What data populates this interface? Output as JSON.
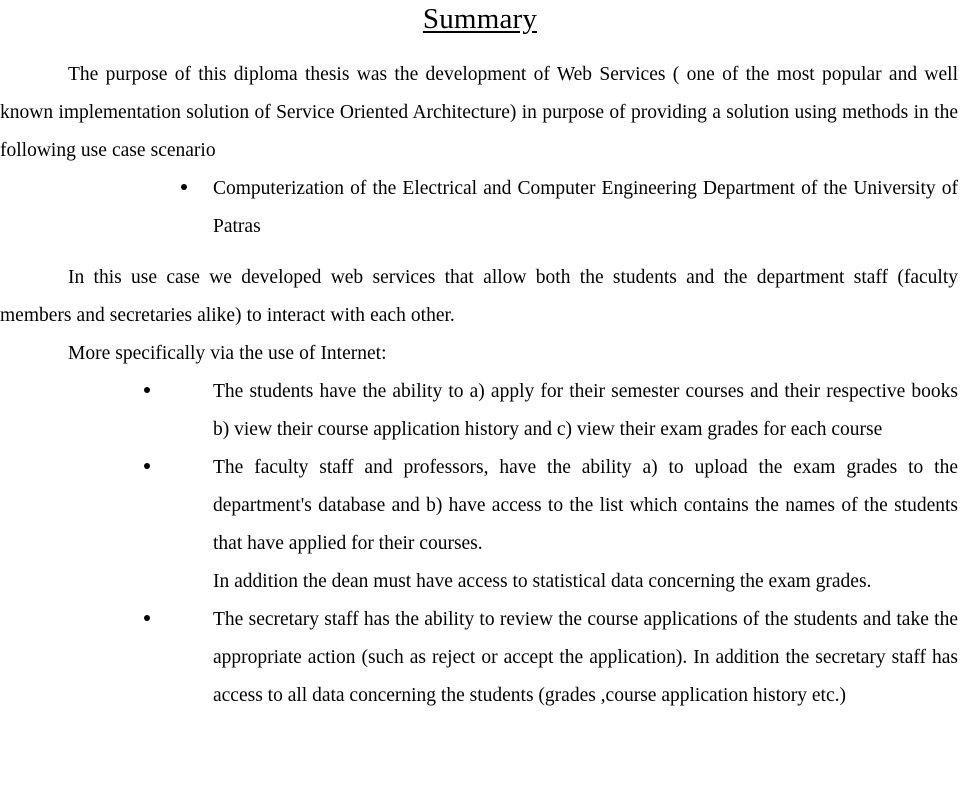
{
  "document": {
    "title": "Summary",
    "title_style": "underlined-centered",
    "text_color": "#000000",
    "background_color": "#ffffff"
  },
  "intro": {
    "paragraph_1": "The purpose of this diploma thesis was the development of Web Services ( one of the most popular and well known implementation solution of Service Oriented Architecture) in purpose of providing a solution using methods in the following use case scenario"
  },
  "scenario_list": {
    "bullet_symbol": "•",
    "items": [
      {
        "text": "Computerization of the Electrical and Computer Engineering Department of the University of Patras"
      }
    ]
  },
  "middle": {
    "paragraph_2": "In this use case we developed web services that allow both the students and the department staff (faculty members and secretaries alike) to interact with each other.",
    "paragraph_3": "More specifically via the use of Internet:"
  },
  "capabilities_list": {
    "bullet_symbol": "•",
    "items": [
      {
        "text": "The students have the ability to a) apply for their semester courses and their respective books b) view their course application history and c) view their exam grades for each course",
        "sub": ""
      },
      {
        "text": "The faculty staff and professors, have the ability a) to upload the exam grades to the department's database and b) have access to the list which contains the names of the students that have applied for their courses.",
        "sub": "In addition the dean must have access to statistical data concerning the exam grades."
      },
      {
        "text": "The secretary staff has the ability to review the course applications of the students and take the appropriate action (such as reject or accept the application). In addition the secretary staff has access to all data concerning the students (grades ,course application history etc.)",
        "sub": ""
      }
    ]
  }
}
